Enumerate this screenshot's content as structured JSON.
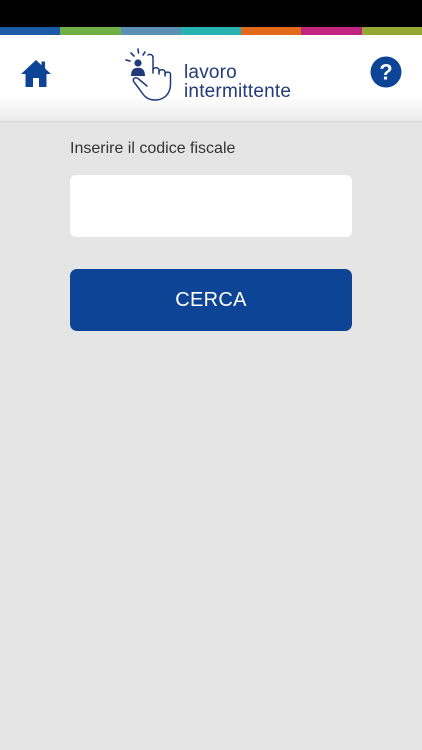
{
  "header": {
    "stripe_colors": [
      "#1a5aa6",
      "#72b046",
      "#5b8fb3",
      "#28b3b3",
      "#e26b1b",
      "#c2257f",
      "#95a631"
    ],
    "accent_color": "#0d4496",
    "logo_text_line1": "lavoro",
    "logo_text_line2": "intermittente",
    "home_icon": "home-icon",
    "help_icon": "question-mark-icon",
    "help_glyph": "?"
  },
  "form": {
    "label": "Inserire il codice fiscale",
    "input_value": "",
    "input_placeholder": "",
    "button_label": "CERCA",
    "button_color": "#0d4496"
  }
}
